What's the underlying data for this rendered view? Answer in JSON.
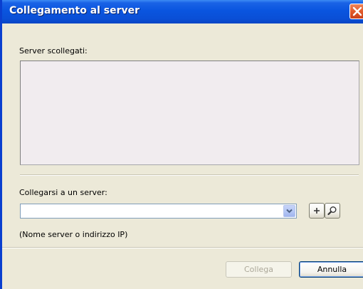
{
  "window": {
    "title": "Collegamento al server"
  },
  "server_list": {
    "label": "Server scollegati:",
    "items": []
  },
  "connect_section": {
    "label": "Collegarsi a un server:",
    "input_value": "",
    "hint": "(Nome server o indirizzo IP)"
  },
  "icons": {
    "add": "plus-icon",
    "search": "magnifier-icon",
    "close": "close-icon",
    "dropdown": "chevron-down-icon"
  },
  "buttons": {
    "connect": "Collega",
    "cancel": "Annulla"
  },
  "colors": {
    "titlebar": "#0a55df",
    "close": "#e25a2a",
    "dialog_bg": "#ece9d8",
    "list_bg": "#f1ecef"
  }
}
